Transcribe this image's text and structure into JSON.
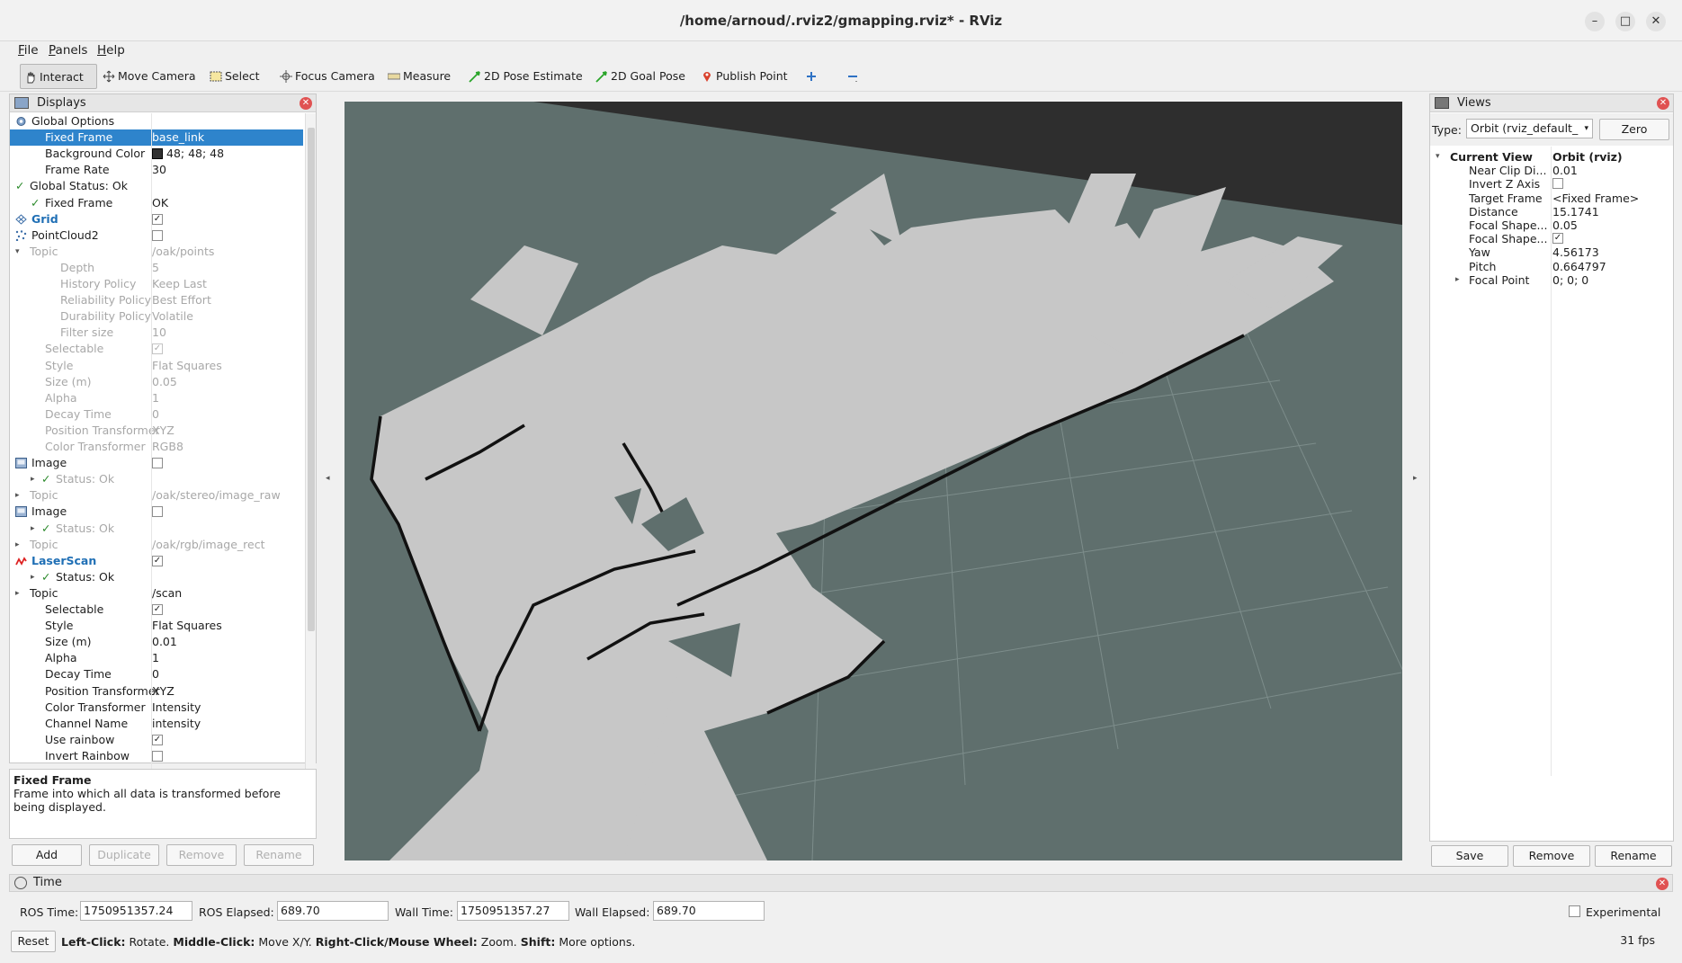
{
  "window": {
    "title": "/home/arnoud/.rviz2/gmapping.rviz* - RViz"
  },
  "menu": [
    "File",
    "Panels",
    "Help"
  ],
  "toolbar": [
    {
      "label": "Interact",
      "icon": "hand-icon",
      "active": true
    },
    {
      "label": "Move Camera",
      "icon": "move-camera-icon"
    },
    {
      "label": "Select",
      "icon": "select-icon"
    },
    {
      "label": "Focus Camera",
      "icon": "focus-camera-icon"
    },
    {
      "label": "Measure",
      "icon": "ruler-icon"
    },
    {
      "label": "2D Pose Estimate",
      "icon": "green-arrow-icon"
    },
    {
      "label": "2D Goal Pose",
      "icon": "green-arrow-icon"
    },
    {
      "label": "Publish Point",
      "icon": "map-pin-icon"
    }
  ],
  "displays": {
    "title": "Displays",
    "rows": [
      {
        "key": "Global Options",
        "indent": 1,
        "icon": "gear-icon"
      },
      {
        "key": "Fixed Frame",
        "value": "base_link",
        "indent": 2,
        "selected": true
      },
      {
        "key": "Background Color",
        "value": "48; 48; 48",
        "indent": 2,
        "swatch": "#303030"
      },
      {
        "key": "Frame Rate",
        "value": "30",
        "indent": 2
      },
      {
        "key": "Global Status: Ok",
        "indent": 1,
        "check": true
      },
      {
        "key": "Fixed Frame",
        "value": "OK",
        "indent": 2,
        "check": true
      },
      {
        "key": "Grid",
        "indent": 1,
        "bold": true,
        "icon": "grid-icon",
        "box": "✓"
      },
      {
        "key": "PointCloud2",
        "indent": 1,
        "icon": "pointcloud-icon",
        "box": ""
      },
      {
        "key": "Topic",
        "value": "/oak/points",
        "indent": 1,
        "disabled": true,
        "arrow": "▾"
      },
      {
        "key": "Depth",
        "value": "5",
        "indent": 3,
        "disabled": true
      },
      {
        "key": "History Policy",
        "value": "Keep Last",
        "indent": 3,
        "disabled": true
      },
      {
        "key": "Reliability Policy",
        "value": "Best Effort",
        "indent": 3,
        "disabled": true
      },
      {
        "key": "Durability Policy",
        "value": "Volatile",
        "indent": 3,
        "disabled": true
      },
      {
        "key": "Filter size",
        "value": "10",
        "indent": 3,
        "disabled": true
      },
      {
        "key": "Selectable",
        "indent": 2,
        "disabled": true,
        "box": "✓"
      },
      {
        "key": "Style",
        "value": "Flat Squares",
        "indent": 2,
        "disabled": true
      },
      {
        "key": "Size (m)",
        "value": "0.05",
        "indent": 2,
        "disabled": true
      },
      {
        "key": "Alpha",
        "value": "1",
        "indent": 2,
        "disabled": true
      },
      {
        "key": "Decay Time",
        "value": "0",
        "indent": 2,
        "disabled": true
      },
      {
        "key": "Position Transformer",
        "value": "XYZ",
        "indent": 2,
        "disabled": true
      },
      {
        "key": "Color Transformer",
        "value": "RGB8",
        "indent": 2,
        "disabled": true
      },
      {
        "key": "Image",
        "indent": 1,
        "icon": "image-icon",
        "box": ""
      },
      {
        "key": "Status: Ok",
        "indent": 2,
        "disabled": true,
        "arrow": "▸",
        "check": true
      },
      {
        "key": "Topic",
        "value": "/oak/stereo/image_raw",
        "indent": 1,
        "disabled": true,
        "arrow": "▸"
      },
      {
        "key": "Image",
        "indent": 1,
        "icon": "image-icon",
        "box": ""
      },
      {
        "key": "Status: Ok",
        "indent": 2,
        "disabled": true,
        "arrow": "▸",
        "check": true
      },
      {
        "key": "Topic",
        "value": "/oak/rgb/image_rect",
        "indent": 1,
        "disabled": true,
        "arrow": "▸"
      },
      {
        "key": "LaserScan",
        "indent": 1,
        "bold": true,
        "icon": "laserscan-icon",
        "box": "✓"
      },
      {
        "key": "Status: Ok",
        "indent": 2,
        "arrow": "▸",
        "check": true
      },
      {
        "key": "Topic",
        "value": "/scan",
        "indent": 1,
        "arrow": "▸"
      },
      {
        "key": "Selectable",
        "indent": 2,
        "box": "✓"
      },
      {
        "key": "Style",
        "value": "Flat Squares",
        "indent": 2
      },
      {
        "key": "Size (m)",
        "value": "0.01",
        "indent": 2
      },
      {
        "key": "Alpha",
        "value": "1",
        "indent": 2
      },
      {
        "key": "Decay Time",
        "value": "0",
        "indent": 2
      },
      {
        "key": "Position Transformer",
        "value": "XYZ",
        "indent": 2
      },
      {
        "key": "Color Transformer",
        "value": "Intensity",
        "indent": 2
      },
      {
        "key": "Channel Name",
        "value": "intensity",
        "indent": 2
      },
      {
        "key": "Use rainbow",
        "indent": 2,
        "box": "✓"
      },
      {
        "key": "Invert Rainbow",
        "indent": 2,
        "box": ""
      }
    ],
    "description_title": "Fixed Frame",
    "description_text": "Frame into which all data is transformed before being displayed.",
    "buttons": [
      {
        "label": "Add",
        "enabled": true
      },
      {
        "label": "Duplicate",
        "enabled": false
      },
      {
        "label": "Remove",
        "enabled": false
      },
      {
        "label": "Rename",
        "enabled": false
      }
    ]
  },
  "views": {
    "title": "Views",
    "type_label": "Type:",
    "type_value": "Orbit (rviz_default_",
    "zero_label": "Zero",
    "rows": [
      {
        "key": "Current View",
        "value": "Orbit (rviz)",
        "head": true
      },
      {
        "key": "Near Clip Di...",
        "value": "0.01"
      },
      {
        "key": "Invert Z Axis",
        "box": ""
      },
      {
        "key": "Target Frame",
        "value": "<Fixed Frame>"
      },
      {
        "key": "Distance",
        "value": "15.1741"
      },
      {
        "key": "Focal Shape...",
        "value": "0.05"
      },
      {
        "key": "Focal Shape...",
        "box": "✓"
      },
      {
        "key": "Yaw",
        "value": "4.56173"
      },
      {
        "key": "Pitch",
        "value": "0.664797"
      },
      {
        "key": "Focal Point",
        "value": "0; 0; 0",
        "arrow": true
      }
    ],
    "buttons": [
      "Save",
      "Remove",
      "Rename"
    ]
  },
  "time": {
    "title": "Time",
    "ros_time_label": "ROS Time:",
    "ros_time": "1750951357.24",
    "ros_elapsed_label": "ROS Elapsed:",
    "ros_elapsed": "689.70",
    "wall_time_label": "Wall Time:",
    "wall_time": "1750951357.27",
    "wall_elapsed_label": "Wall Elapsed:",
    "wall_elapsed": "689.70",
    "experimental_label": "Experimental",
    "reset_label": "Reset",
    "fps": "31 fps"
  },
  "status_hint": [
    {
      "b": "Left-Click:",
      "t": " Rotate. "
    },
    {
      "b": "Middle-Click:",
      "t": " Move X/Y. "
    },
    {
      "b": "Right-Click/Mouse Wheel:",
      "t": " Zoom. "
    },
    {
      "b": "Shift:",
      "t": " More options."
    }
  ]
}
